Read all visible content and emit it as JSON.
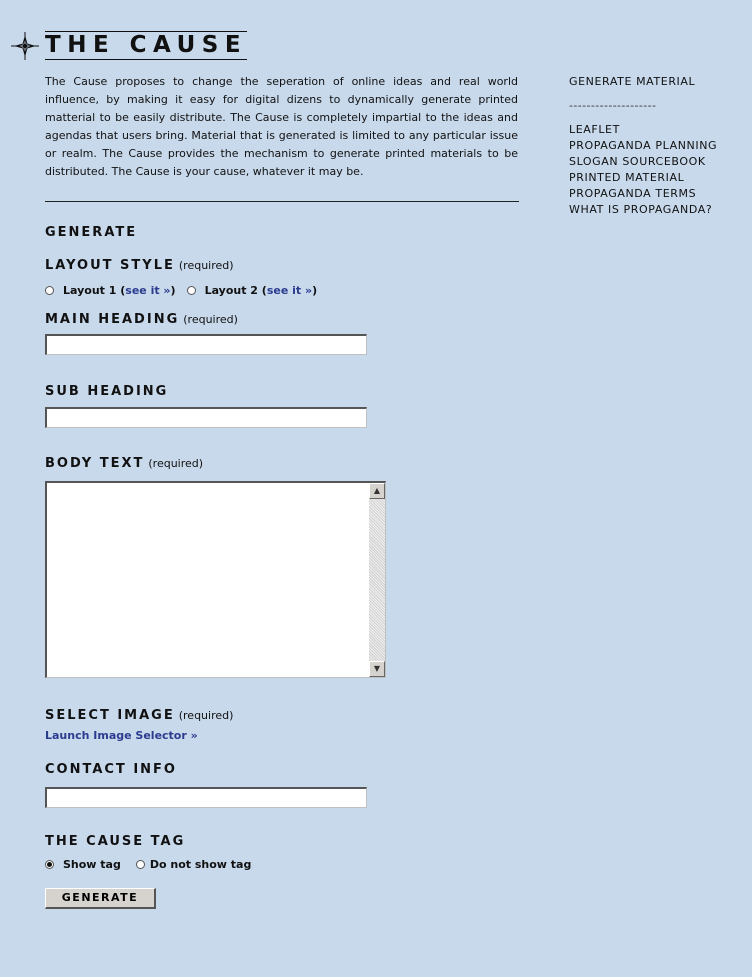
{
  "logo": {
    "title": "THE CAUSE",
    "icon": "compass-star-icon"
  },
  "intro": {
    "text": "The Cause proposes to change the seperation of online ideas and real world influence, by making it easy for digital dizens to dynamically generate printed matterial to be easily distribute. The Cause is completely impartial to the ideas and agendas that users bring. Material that is generated is limited to any particular issue or realm. The Cause  provides the mechanism to generate printed materials to be distributed. The Cause is your cause, whatever it may be."
  },
  "sidebar": {
    "heading": "GENERATE MATERIAL",
    "separator": "--------------------",
    "items": [
      "LEAFLET",
      "PROPAGANDA PLANNING",
      "SLOGAN SOURCEBOOK",
      "PRINTED MATERIAL",
      "PROPAGANDA TERMS",
      "WHAT IS PROPAGANDA?"
    ]
  },
  "form": {
    "title": "GENERATE",
    "required": "(required)",
    "layout_style": {
      "label": "LAYOUT STYLE",
      "options": [
        {
          "label": "Layout 1",
          "link": "see it »",
          "checked": false
        },
        {
          "label": "Layout 2",
          "link": "see it »",
          "checked": false
        }
      ]
    },
    "main_heading": {
      "label": "MAIN HEADING",
      "value": ""
    },
    "sub_heading": {
      "label": "SUB HEADING",
      "value": ""
    },
    "body_text": {
      "label": "BODY TEXT",
      "value": ""
    },
    "select_image": {
      "label": "SELECT IMAGE",
      "link": "Launch Image Selector »"
    },
    "contact_info": {
      "label": "CONTACT INFO",
      "value": ""
    },
    "cause_tag": {
      "label": "THE CAUSE TAG",
      "options": [
        {
          "label": "Show tag",
          "checked": true
        },
        {
          "label": "Do not show tag",
          "checked": false
        }
      ]
    },
    "submit": "GENERATE"
  }
}
